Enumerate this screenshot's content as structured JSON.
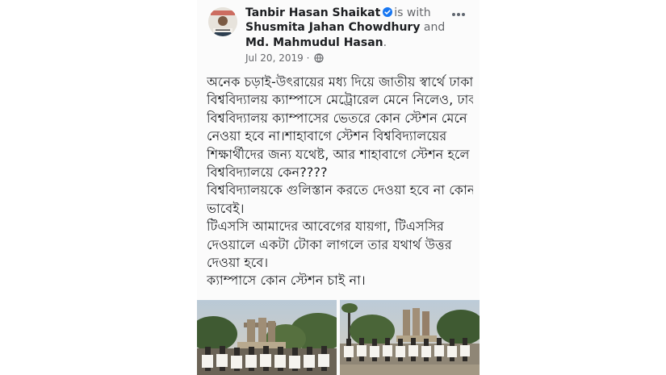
{
  "post": {
    "author": "Tanbir Hasan Shaikat",
    "is_with": "is with",
    "tagged_1": "Shusmita Jahan Chowdhury",
    "and": "and",
    "tagged_2": "Md. Mahmudul Hasan",
    "period": ".",
    "date": "Jul 20, 2019",
    "separator": "·",
    "privacy_icon": "globe-icon",
    "menu_icon": "more-icon",
    "body_lines": [
      "অনেক চড়াই-উৎরায়ের মধ্য দিয়ে জাতীয় স্বার্থে ঢাকা",
      "বিশ্ববিদ্যালয় ক্যাম্পাসে মেট্রোরেল মেনে নিলেও, ঢাকা",
      "বিশ্ববিদ্যালয় ক্যাম্পাসের ভেতরে কোন স্টেশন মেনে",
      "নেওয়া হবে না।শাহাবাগে স্টেশন বিশ্ববিদ্যালয়ের",
      "শিক্ষার্থীদের জন্য যথেষ্ট, আর শাহাবাগে স্টেশন হলে",
      "বিশ্ববিদ্যালয়ে কেন????",
      "বিশ্ববিদ্যালয়কে গুলিস্তান করতে দেওয়া হবে না কোন",
      "ভাবেই।",
      "টিএসসি আমাদের আবেগের যায়গা, টিএসসির",
      "দেওয়ালে একটা টোকা লাগলে তার যথার্থ উত্তর",
      "দেওয়া হবে।",
      "ক্যাম্পাসে কোন স্টেশন চাই না।"
    ]
  },
  "colors": {
    "name": "#1c1e21",
    "secondary": "#65676b",
    "verified": "#1877f2"
  }
}
